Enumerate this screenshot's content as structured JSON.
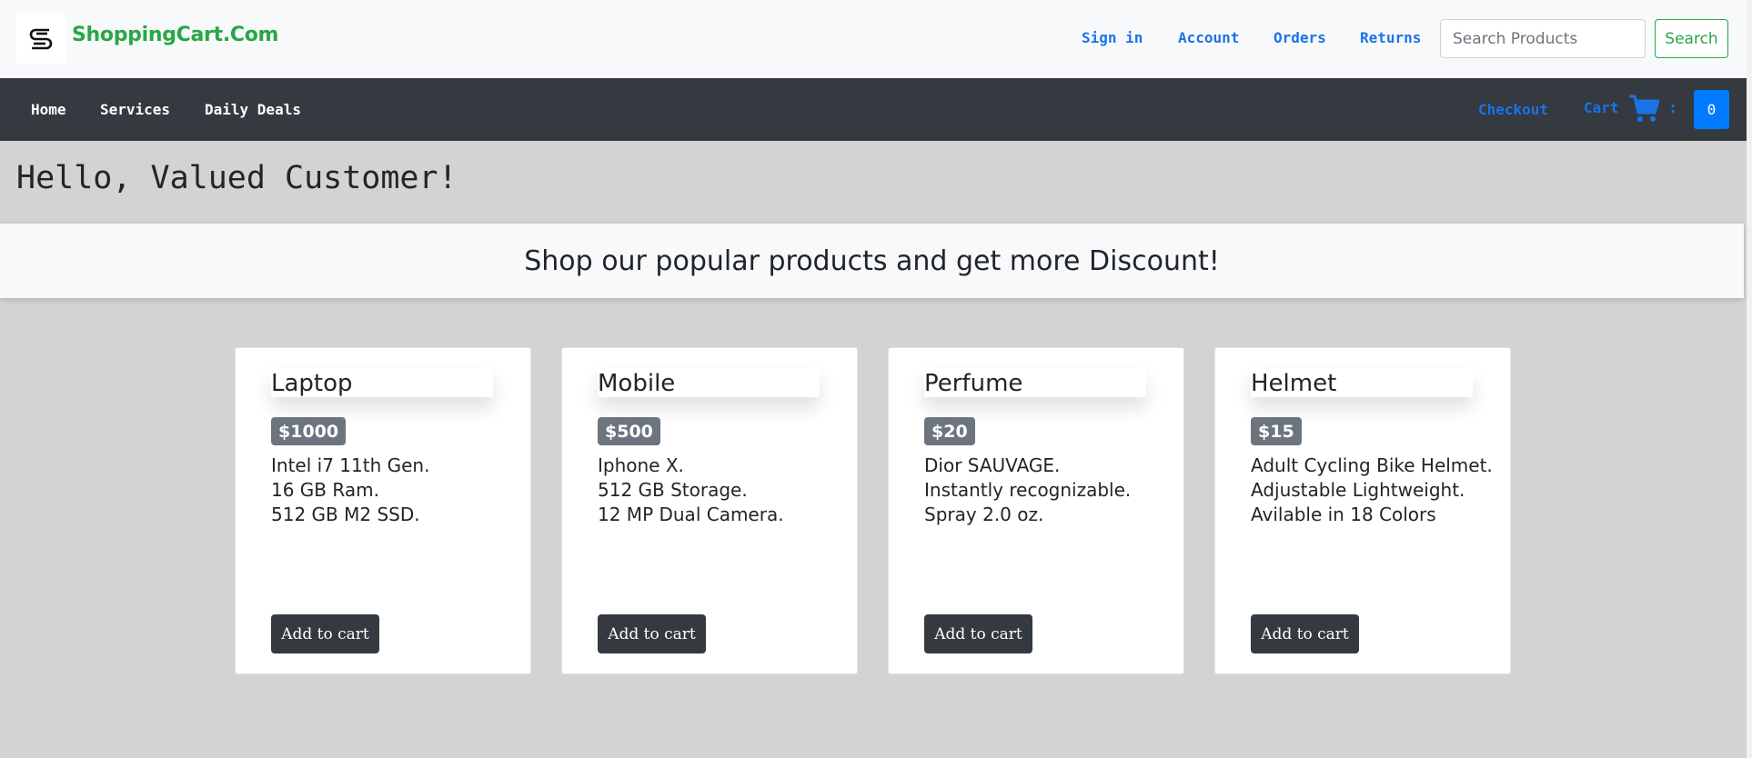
{
  "header": {
    "brand": "ShoppingCart.Com",
    "logo_icon": "s-logo-icon",
    "links": [
      "Sign in",
      "Account",
      "Orders",
      "Returns"
    ],
    "search": {
      "placeholder": "Search Products",
      "button_label": "Search"
    }
  },
  "nav": {
    "left_items": [
      "Home",
      "Services",
      "Daily Deals"
    ],
    "checkout_label": "Checkout",
    "cart_label": "Cart",
    "cart_icon": "shopping-cart-icon",
    "cart_separator": ":",
    "cart_count": "0"
  },
  "greeting": "Hello, Valued Customer!",
  "banner": "Shop our popular products and get more Discount!",
  "products": [
    {
      "title": "Laptop",
      "price": "$1000",
      "desc": [
        "Intel i7 11th Gen.",
        "16 GB Ram.",
        "512 GB M2 SSD."
      ],
      "button": "Add to cart"
    },
    {
      "title": "Mobile",
      "price": "$500",
      "desc": [
        "Iphone X.",
        "512 GB Storage.",
        "12 MP Dual Camera."
      ],
      "button": "Add to cart"
    },
    {
      "title": "Perfume",
      "price": "$20",
      "desc": [
        "Dior SAUVAGE.",
        "Instantly recognizable.",
        "Spray 2.0 oz."
      ],
      "button": "Add to cart"
    },
    {
      "title": "Helmet",
      "price": "$15",
      "desc": [
        "Adult Cycling Bike Helmet.",
        "Adjustable Lightweight.",
        "Avilable in 18 Colors"
      ],
      "button": "Add to cart"
    }
  ],
  "colors": {
    "brand": "#28a745",
    "link": "#1a73e8",
    "dark": "#343a40",
    "badge": "#6c757d",
    "cart_count_bg": "#007bff",
    "page_bg": "#d3d3d3"
  }
}
